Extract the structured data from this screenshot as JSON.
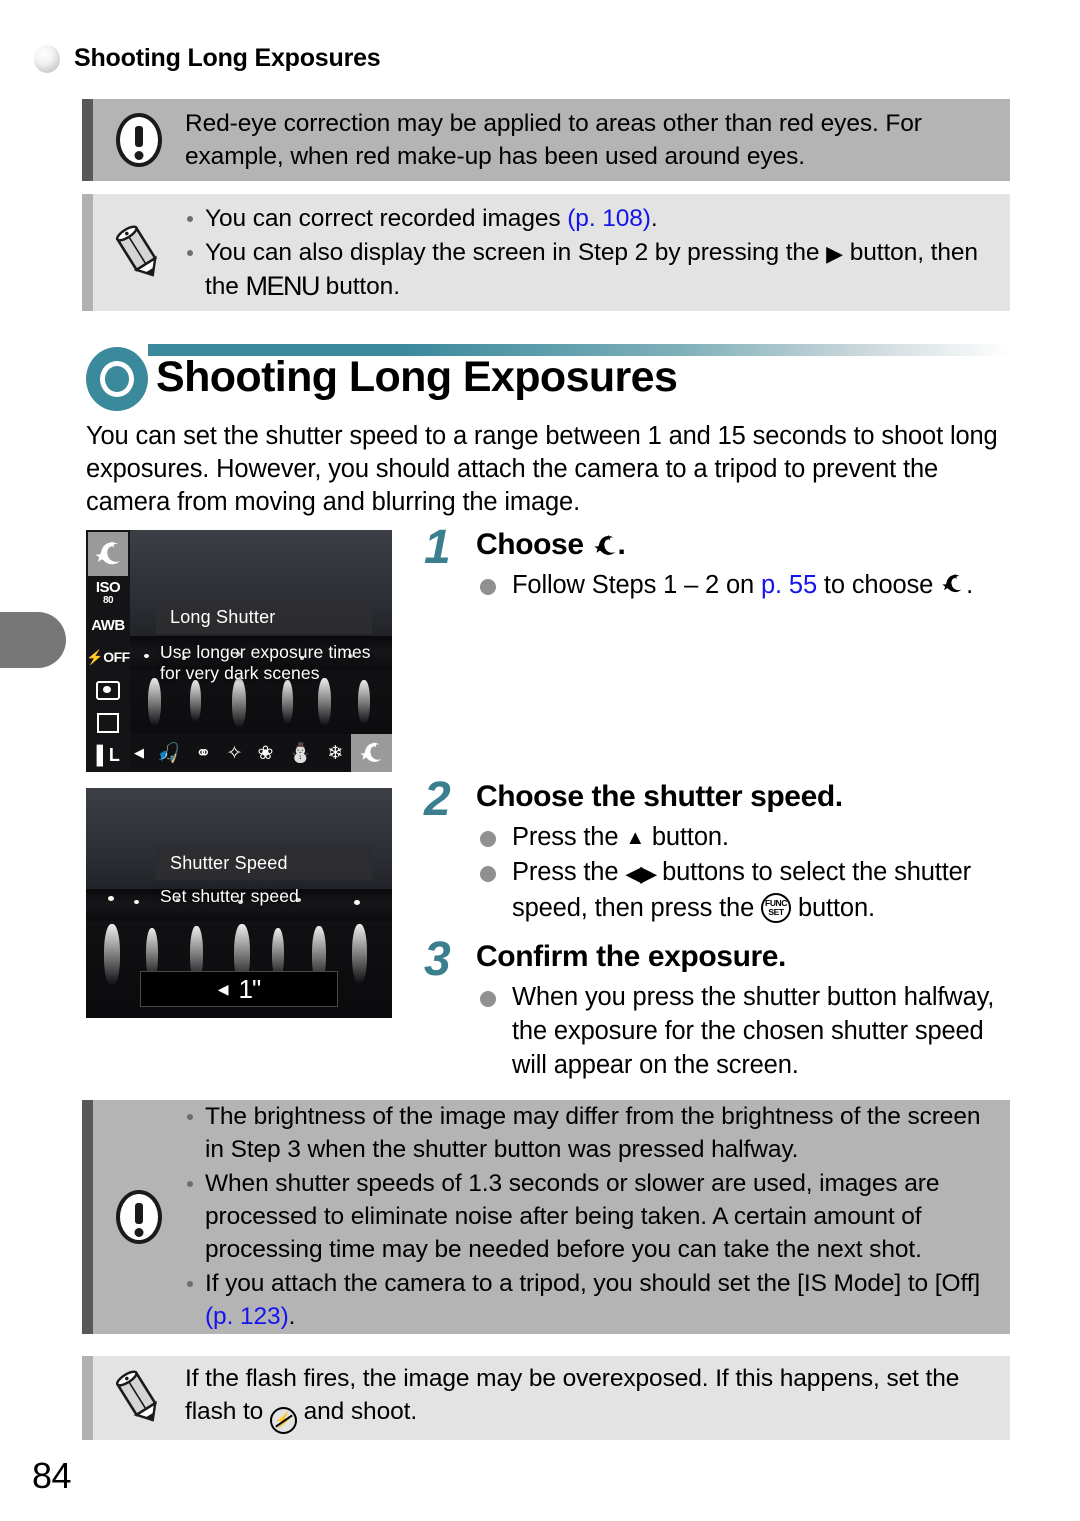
{
  "page": {
    "number": "84",
    "running_header": "Shooting Long Exposures",
    "accent_teal": "#3b8a9c",
    "link_blue": "#1414ee"
  },
  "warning_top": {
    "icon": "warning-exclamation-icon",
    "text": "Red-eye correction may be applied to areas other than red eyes. For example, when red make-up has been used around eyes."
  },
  "note_top": {
    "icon": "pencil-note-icon",
    "items": [
      {
        "pre": "You can correct recorded images ",
        "ref": "(p. 108)",
        "post": "."
      },
      {
        "pre": "You can also display the screen in Step 2 by pressing the ",
        "mid": " button, then the ",
        "menu": "MENU",
        "post": " button."
      }
    ]
  },
  "section": {
    "icon": "ring-bullet-icon",
    "title": "Shooting Long Exposures",
    "intro": "You can set the shutter speed to a range between 1 and 15 seconds to shoot long exposures. However, you should attach the camera to a tripod to prevent the camera from moving and blurring the image."
  },
  "shot1": {
    "name": "long-shutter-mode-screen",
    "rail": [
      {
        "label": "moon-star-icon",
        "selected": true
      },
      {
        "label": "ISO",
        "sub": "80",
        "selected": false
      },
      {
        "label": "AWB",
        "selected": false
      },
      {
        "label": "flash-off-icon",
        "selected": false
      },
      {
        "label": "metering-icon",
        "selected": false
      },
      {
        "label": "drive-single-icon",
        "selected": false
      },
      {
        "label": "image-quality-L-icon",
        "selected": false
      }
    ],
    "osd_title": "Long Shutter",
    "osd_desc_line1": "Use longer exposure times",
    "osd_desc_line2": "for very dark scenes",
    "mode_strip": [
      "portrait-icon",
      "kids-pets-icon",
      "indoor-icon",
      "foliage-icon",
      "snow-icon",
      "fireworks-icon",
      "long-shutter-icon"
    ],
    "mode_strip_selected_index": 6
  },
  "shot2": {
    "name": "shutter-speed-screen",
    "osd_title": "Shutter Speed",
    "osd_desc": "Set shutter speed",
    "speed_value": "1\""
  },
  "steps": [
    {
      "number": "1",
      "headline_pre": "Choose ",
      "headline_glyph": "moon-star-icon",
      "headline_post": ".",
      "bullets": [
        {
          "pre": "Follow Steps 1 – 2 on ",
          "ref": "p. 55",
          "mid": " to choose ",
          "glyph": "moon-star-icon",
          "post": "."
        }
      ]
    },
    {
      "number": "2",
      "headline": "Choose the shutter speed.",
      "bullets": [
        {
          "pre": "Press the ",
          "glyph": "up-arrow-button-icon",
          "post": " button."
        },
        {
          "pre": "Press the ",
          "glyph": "left-right-arrow-buttons-icon",
          "mid": " buttons to select the shutter speed, then press the ",
          "glyph2": "func-set-button-icon",
          "post": " button."
        }
      ]
    },
    {
      "number": "3",
      "headline": "Confirm the exposure.",
      "bullets": [
        {
          "text": "When you press the shutter button halfway, the exposure for the chosen shutter speed will appear on the screen."
        }
      ]
    }
  ],
  "warning_bottom": {
    "icon": "warning-exclamation-icon",
    "items": [
      {
        "text": "The brightness of the image may differ from the brightness of the screen in Step 3 when the shutter button was pressed halfway."
      },
      {
        "text": "When shutter speeds of 1.3 seconds or slower are used, images are processed to eliminate noise after being taken. A certain amount of processing time may be needed before you can take the next shot."
      },
      {
        "pre": "If you attach the camera to a tripod, you should set the [IS Mode] to [Off] ",
        "ref": "(p. 123)",
        "post": "."
      }
    ]
  },
  "note_bottom": {
    "icon": "pencil-note-icon",
    "pre": "If the flash fires, the image may be overexposed. If this happens, set the flash to ",
    "glyph": "flash-off-icon",
    "post": " and shoot."
  }
}
